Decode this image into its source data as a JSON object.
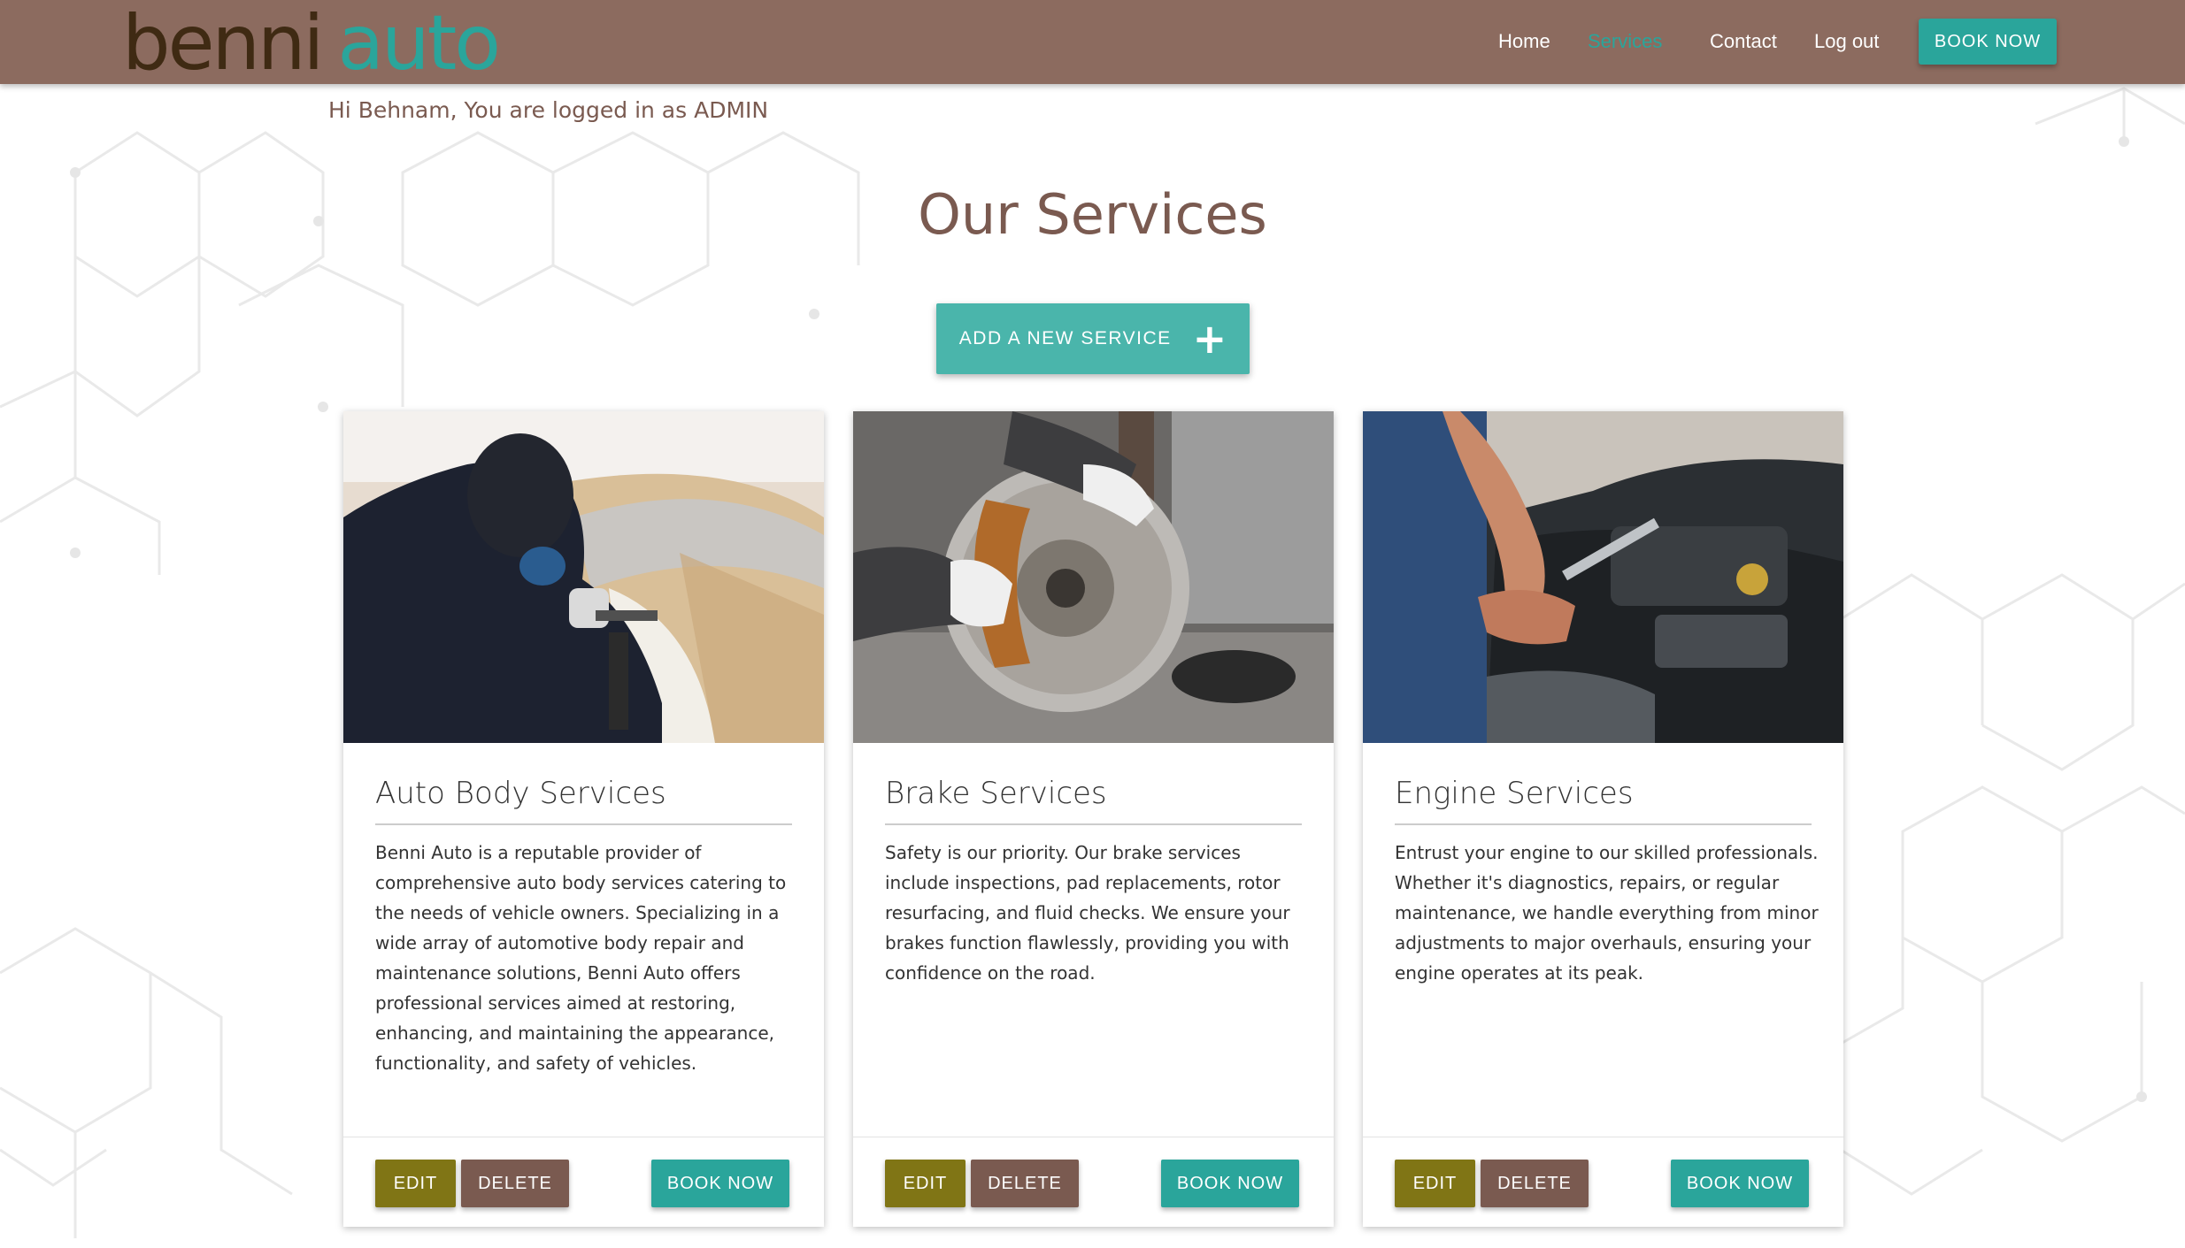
{
  "brand": {
    "logo_word1": "benni",
    "logo_word2": "auto"
  },
  "nav": {
    "links": [
      {
        "label": "Home",
        "active": false
      },
      {
        "label": "Services",
        "active": true
      },
      {
        "label": "Contact",
        "active": false
      },
      {
        "label": "Log out",
        "active": false
      }
    ],
    "book_label": "BOOK NOW"
  },
  "greeting": "Hi Behnam, You are logged in as ADMIN",
  "page_title": "Our Services",
  "add_service": {
    "label": "ADD A NEW SERVICE",
    "icon": "plus-icon"
  },
  "cards": [
    {
      "title": "Auto Body Services",
      "image": "auto-body-spray-painting-photo",
      "text": "Benni Auto is a reputable provider of comprehensive auto body services catering to the needs of vehicle owners. Specializing in a wide array of automotive body repair and maintenance solutions, Benni Auto offers professional services aimed at restoring, enhancing, and maintaining the appearance, functionality, and safety of vehicles.",
      "edit_label": "EDIT",
      "delete_label": "DELETE",
      "book_label": "BOOK NOW"
    },
    {
      "title": "Brake Services",
      "image": "brake-disc-repair-photo",
      "text": "Safety is our priority. Our brake services include inspections, pad replacements, rotor resurfacing, and fluid checks. We ensure your brakes function flawlessly, providing you with confidence on the road.",
      "edit_label": "EDIT",
      "delete_label": "DELETE",
      "book_label": "BOOK NOW"
    },
    {
      "title": "Engine Services",
      "image": "engine-repair-photo",
      "text": "Entrust your engine to our skilled professionals. Whether it's diagnostics, repairs, or regular maintenance, we handle everything from minor adjustments to major overhauls, ensuring your engine operates at its peak.",
      "edit_label": "EDIT",
      "delete_label": "DELETE",
      "book_label": "BOOK NOW"
    }
  ],
  "colors": {
    "navbar": "#8c6b5f",
    "teal": "#2aa59b",
    "olive": "#807515",
    "brown": "#7a5a50",
    "logo_dark": "#3f2a13"
  }
}
